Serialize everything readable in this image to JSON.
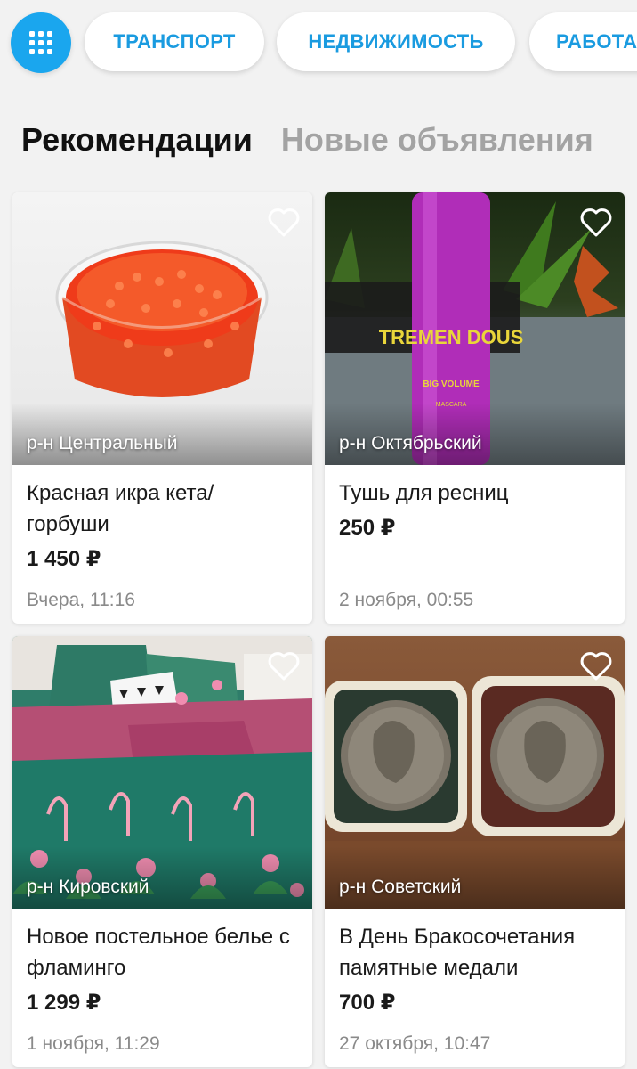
{
  "categories": [
    {
      "label": "ТРАНСПОРТ"
    },
    {
      "label": "НЕДВИЖИМОСТЬ"
    },
    {
      "label": "РАБОТА"
    }
  ],
  "tabs": {
    "active": "Рекомендации",
    "inactive": "Новые объявления"
  },
  "listings": [
    {
      "district": "р-н Центральный",
      "title": "Красная икра кета/ горбуши",
      "price": "1 450 ₽",
      "date": "Вчера, 11:16"
    },
    {
      "district": "р-н Октябрьский",
      "title": "Тушь для ресниц",
      "price": "250 ₽",
      "date": "2 ноября, 00:55"
    },
    {
      "district": "р-н Кировский",
      "title": "Новое постельное белье с фламинго",
      "price": "1 299 ₽",
      "date": "1 ноября, 11:29"
    },
    {
      "district": "р-н Советский",
      "title": "В День Бракосочетания памятные медали",
      "price": "700 ₽",
      "date": "27 октября, 10:47"
    }
  ],
  "photo_text": {
    "mascara_brand": "TREMEN DOUS",
    "mascara_sub": "BIG VOLUME",
    "mascara_label": "MASCARA"
  },
  "colors": {
    "accent": "#1aa6ee",
    "chip_text": "#1a9be0",
    "background": "#f2f2f2"
  },
  "icons": [
    "grid-menu-icon",
    "heart-icon"
  ]
}
